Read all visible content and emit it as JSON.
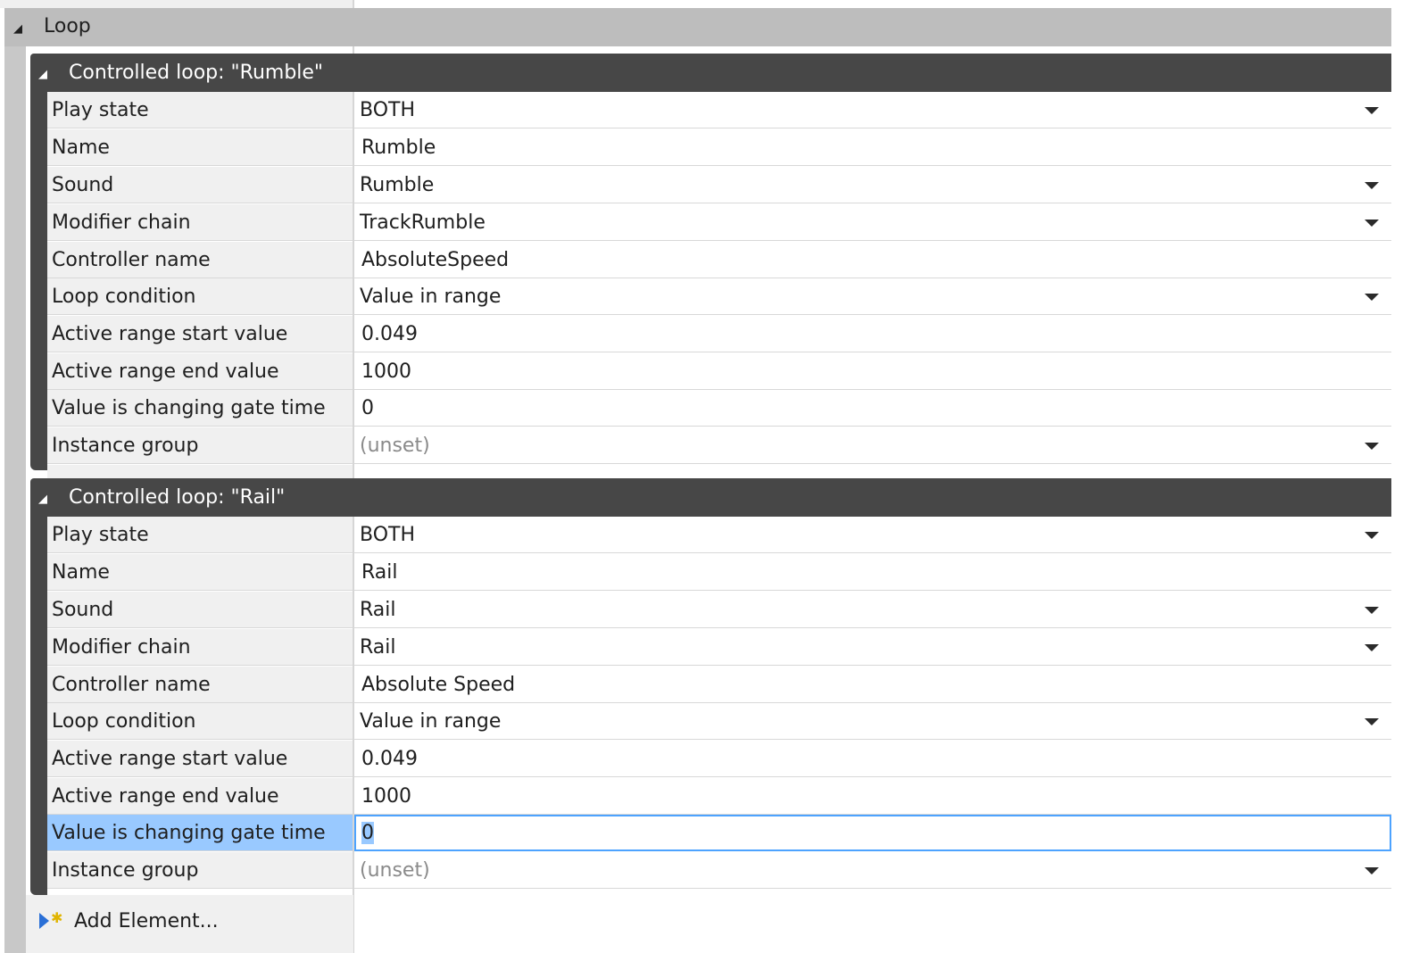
{
  "loop_section": {
    "title": "Loop"
  },
  "groups": [
    {
      "title": "Controlled loop: \"Rumble\"",
      "rows": [
        {
          "label": "Play state",
          "value": "BOTH"
        },
        {
          "label": "Name",
          "value": "Rumble"
        },
        {
          "label": "Sound",
          "value": "Rumble"
        },
        {
          "label": "Modifier chain",
          "value": "TrackRumble"
        },
        {
          "label": "Controller name",
          "value": "AbsoluteSpeed"
        },
        {
          "label": "Loop condition",
          "value": "Value in range"
        },
        {
          "label": "Active range start value",
          "value": "0.049"
        },
        {
          "label": "Active range end value",
          "value": "1000"
        },
        {
          "label": "Value is changing gate time",
          "value": "0"
        },
        {
          "label": "Instance group",
          "value": "(unset)"
        }
      ]
    },
    {
      "title": "Controlled loop: \"Rail\"",
      "rows": [
        {
          "label": "Play state",
          "value": "BOTH"
        },
        {
          "label": "Name",
          "value": "Rail"
        },
        {
          "label": "Sound",
          "value": "Rail"
        },
        {
          "label": "Modifier chain",
          "value": "Rail"
        },
        {
          "label": "Controller name",
          "value": "Absolute Speed"
        },
        {
          "label": "Loop condition",
          "value": "Value in range"
        },
        {
          "label": "Active range start value",
          "value": "0.049"
        },
        {
          "label": "Active range end value",
          "value": "1000"
        },
        {
          "label": "Value is changing gate time",
          "value": "0"
        },
        {
          "label": "Instance group",
          "value": "(unset)"
        }
      ]
    }
  ],
  "add_element": {
    "label": "Add Element..."
  },
  "colors": {
    "group_header": "#474747",
    "loop_header": "#bdbdbd",
    "selection": "#99c9ff",
    "focus_border": "#4da3ff"
  }
}
